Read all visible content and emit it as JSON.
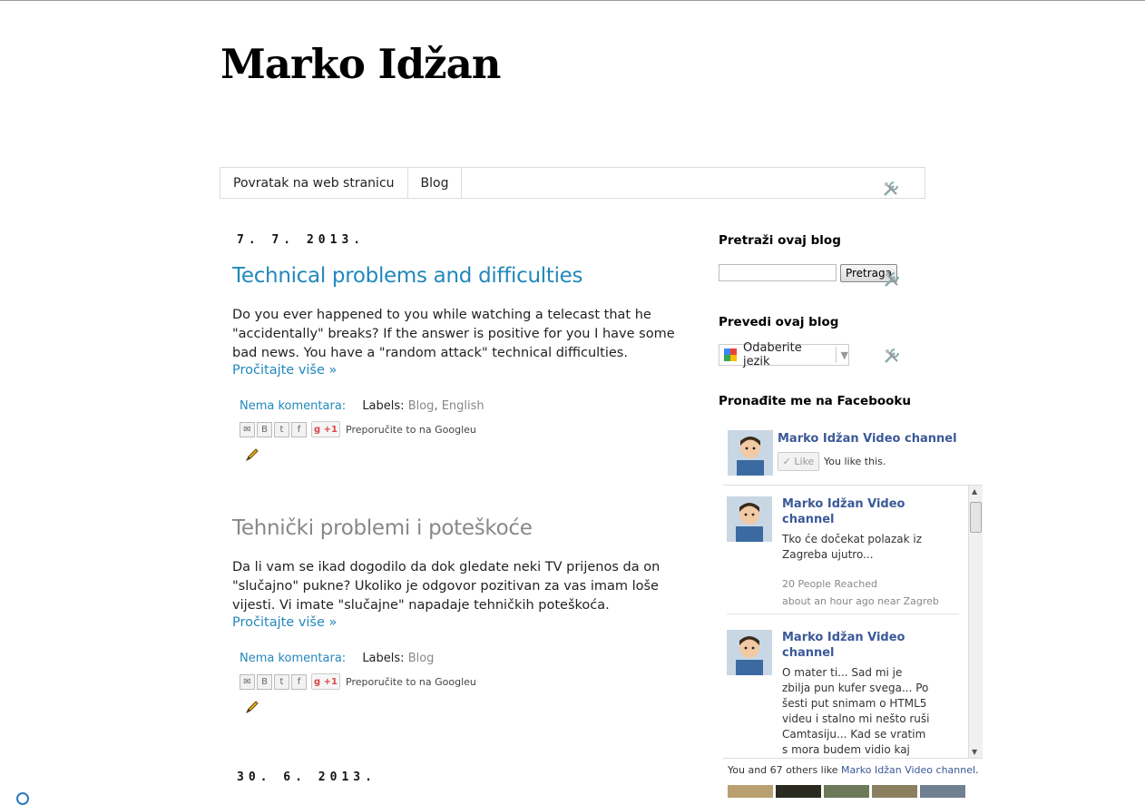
{
  "site": {
    "title": "Marko Idžan"
  },
  "nav": {
    "tabs": [
      "Povratak na web stranicu",
      "Blog"
    ]
  },
  "posts": [
    {
      "date": "7. 7. 2013.",
      "title": "Technical problems and difficulties",
      "body": "Do you ever happened to you while watching a telecast that he \"accidentally\" breaks? If the answer is positive for you I have some bad news. You have a \"random attack\" technical difficulties.",
      "read_more": "Pročitajte više »",
      "comments": "Nema komentara:",
      "labels_title": "Labels:",
      "labels": [
        "Blog",
        "English"
      ],
      "gplus_label": "+1",
      "gplus_text": "Preporučite to na Googleu"
    },
    {
      "title": "Tehnički problemi i poteškoće",
      "body": "Da li vam se ikad dogodilo da dok gledate neki TV prijenos da on \"slučajno\" pukne? Ukoliko je odgovor pozitivan za vas imam loše vijesti. Vi imate \"slučajne\" napadaje tehničkih poteškoća.",
      "read_more": "Pročitajte više »",
      "comments": "Nema komentara:",
      "labels_title": "Labels:",
      "labels": [
        "Blog"
      ],
      "gplus_label": "+1",
      "gplus_text": "Preporučite to na Googleu"
    }
  ],
  "next_date": "30. 6. 2013.",
  "sidebar": {
    "search": {
      "title": "Pretraži ovaj blog",
      "button": "Pretraga",
      "value": ""
    },
    "translate": {
      "title": "Prevedi ovaj blog",
      "select": "Odaberite jezik"
    },
    "facebook": {
      "title": "Pronađite me na Facebooku",
      "page_name": "Marko Idžan Video channel",
      "like_button": "Like",
      "you_like": "You like this.",
      "posts": [
        {
          "name": "Marko Idžan Video channel",
          "text": "Tko će dočekat polazak iz Zagreba ujutro...",
          "reach": "20 People Reached",
          "time": "about an hour ago near Zagreb"
        },
        {
          "name": "Marko Idžan Video channel",
          "text": "O mater ti... Sad mi je zbilja pun kufer svega... Po šesti put snimam o HTML5 videu i stalno mi nešto ruši Camtasiju... Kad se vratim s mora budem vidio kaj ruši"
        }
      ],
      "footer_prefix": "You and 67 others like ",
      "footer_link": "Marko Idžan Video channel",
      "footer_suffix": "."
    }
  },
  "colors": {
    "link": "#2288bb",
    "visited_title": "#888888",
    "fb_blue": "#3b5998"
  }
}
